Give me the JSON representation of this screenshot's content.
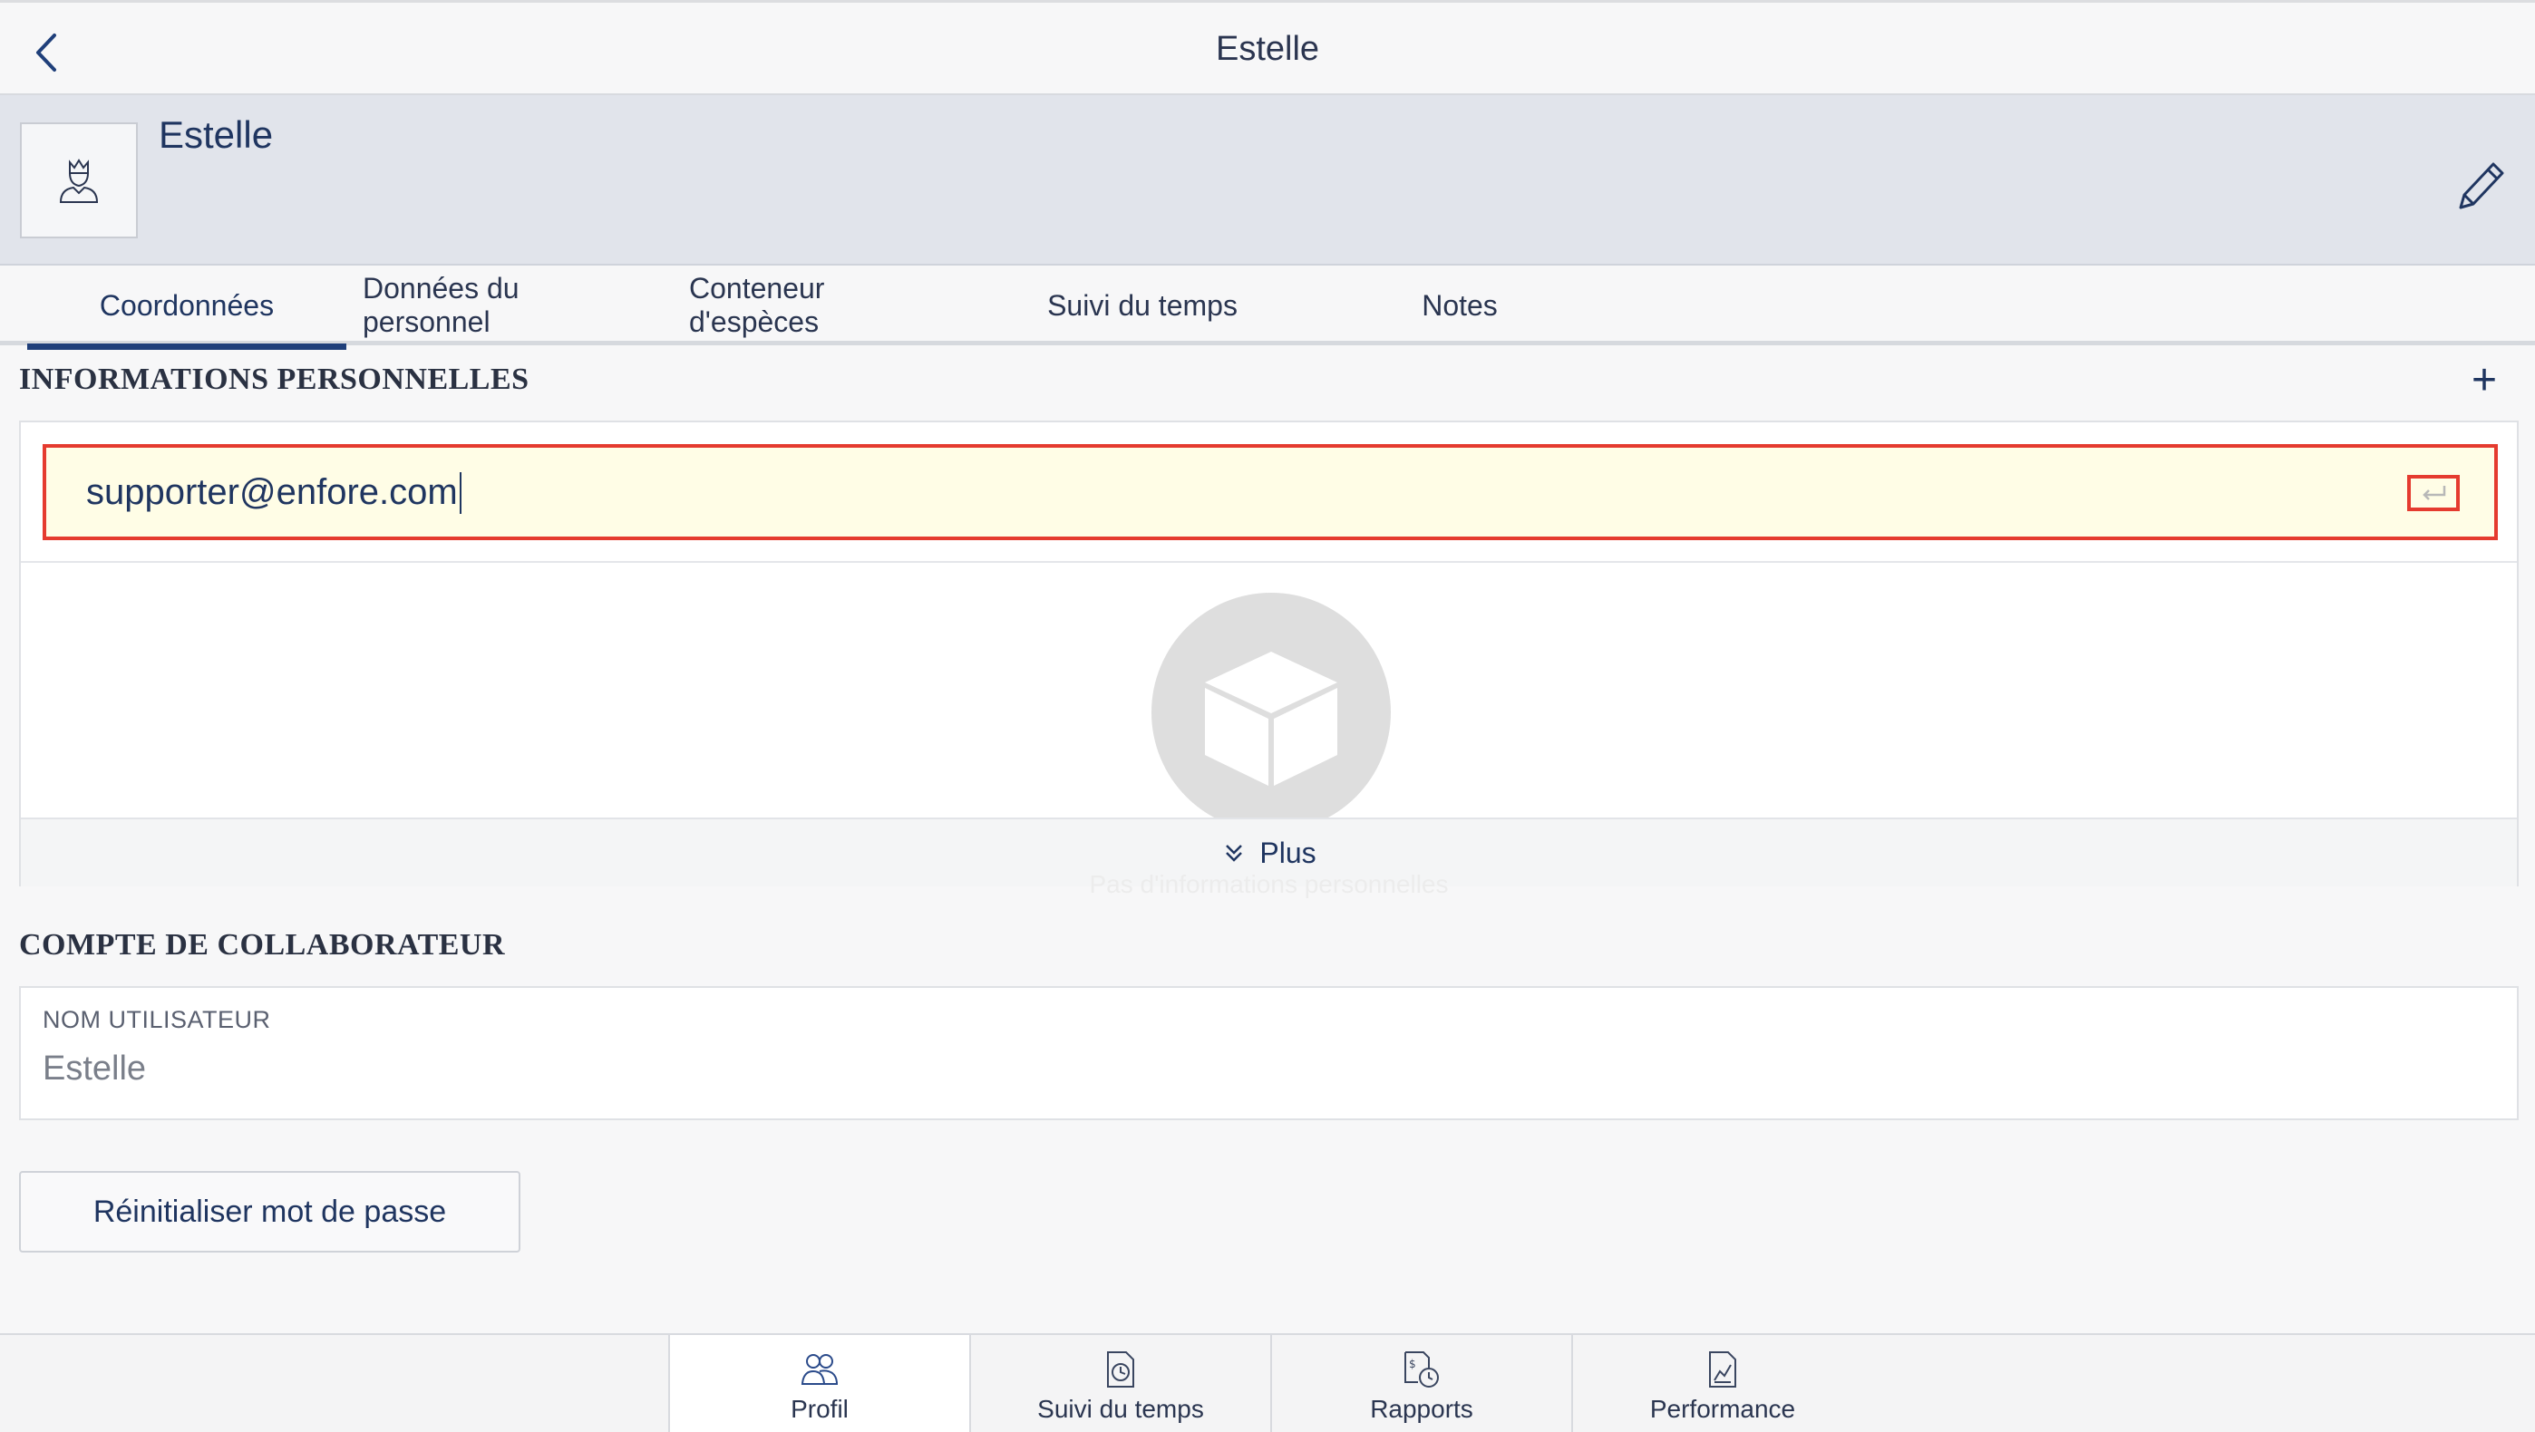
{
  "nav": {
    "title": "Estelle",
    "back_icon": "chevron-left-icon"
  },
  "profile": {
    "name": "Estelle",
    "avatar_icon": "user-avatar-icon",
    "edit_icon": "pencil-icon"
  },
  "tabs": [
    {
      "label": "Coordonnées",
      "active": true
    },
    {
      "label": "Données du personnel",
      "active": false
    },
    {
      "label": "Conteneur d'espèces",
      "active": false
    },
    {
      "label": "Suivi du temps",
      "active": false
    },
    {
      "label": "Notes",
      "active": false
    }
  ],
  "personal_info": {
    "title": "INFORMATIONS PERSONNELLES",
    "add_label": "+",
    "email_value": "supporter@enfore.com",
    "more_label": "Plus",
    "empty_text": "Pas d'informations personnelles",
    "empty_icon": "box-icon"
  },
  "account": {
    "title": "COMPTE DE COLLABORATEUR",
    "username_label": "NOM UTILISATEUR",
    "username_value": "Estelle",
    "reset_label": "Réinitialiser mot de passe"
  },
  "bottom_nav": [
    {
      "label": "Profil",
      "icon": "people-icon",
      "active": true
    },
    {
      "label": "Suivi du temps",
      "icon": "clock-document-icon",
      "active": false
    },
    {
      "label": "Rapports",
      "icon": "reports-icon",
      "active": false
    },
    {
      "label": "Performance",
      "icon": "chart-document-icon",
      "active": false
    }
  ],
  "colors": {
    "accent": "#1f3f7a",
    "highlight": "#e53b2f",
    "input_bg": "#fffde6"
  }
}
